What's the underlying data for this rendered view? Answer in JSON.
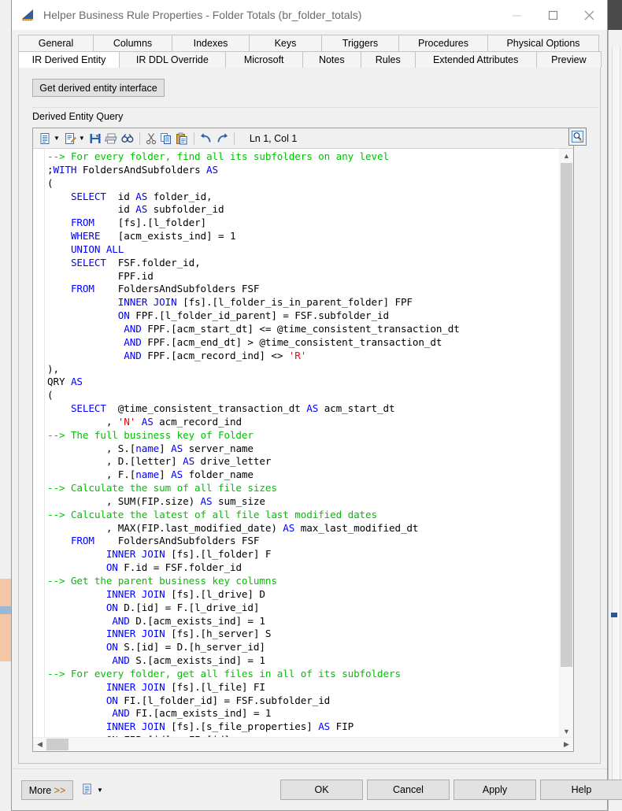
{
  "window": {
    "title": "Helper Business Rule Properties - Folder Totals (br_folder_totals)",
    "minimize_label": "–",
    "maximize_label": "☐",
    "close_label": "✕"
  },
  "tabs": {
    "row1": [
      {
        "label": "General",
        "active": false
      },
      {
        "label": "Columns",
        "active": false
      },
      {
        "label": "Indexes",
        "active": false
      },
      {
        "label": "Keys",
        "active": false
      },
      {
        "label": "Triggers",
        "active": false
      },
      {
        "label": "Procedures",
        "active": false
      },
      {
        "label": "Physical Options",
        "active": false
      }
    ],
    "row2": [
      {
        "label": "IR Derived Entity",
        "active": true
      },
      {
        "label": "IR DDL Override",
        "active": false
      },
      {
        "label": "Microsoft",
        "active": false
      },
      {
        "label": "Notes",
        "active": false
      },
      {
        "label": "Rules",
        "active": false
      },
      {
        "label": "Extended Attributes",
        "active": false
      },
      {
        "label": "Preview",
        "active": false
      }
    ]
  },
  "panel": {
    "get_derived_label": "Get derived entity interface",
    "query_label": "Derived Entity Query"
  },
  "editor_toolbar": {
    "cursor_position": "Ln 1, Col 1",
    "items": [
      {
        "name": "new-document-icon",
        "caret": true
      },
      {
        "name": "edit-document-icon",
        "caret": true
      },
      {
        "name": "save-icon",
        "caret": false
      },
      {
        "name": "print-icon",
        "caret": false
      },
      {
        "name": "find-icon",
        "caret": false
      },
      {
        "name": "cut-icon",
        "caret": false
      },
      {
        "name": "copy-icon",
        "caret": false
      },
      {
        "name": "paste-icon",
        "caret": false
      },
      {
        "name": "undo-icon",
        "caret": false
      },
      {
        "name": "redo-icon",
        "caret": false
      }
    ]
  },
  "code": {
    "language": "sql",
    "lines": [
      [
        {
          "t": "--> For every folder, find all its subfolders on any level",
          "c": "cmt"
        }
      ],
      [
        {
          "t": ";",
          "c": "plain"
        },
        {
          "t": "WITH",
          "c": "kw"
        },
        {
          "t": " FoldersAndSubfolders ",
          "c": "plain"
        },
        {
          "t": "AS",
          "c": "kw"
        }
      ],
      [
        {
          "t": "(",
          "c": "plain"
        }
      ],
      [
        {
          "t": "    ",
          "c": "plain"
        },
        {
          "t": "SELECT",
          "c": "kw"
        },
        {
          "t": "  id ",
          "c": "plain"
        },
        {
          "t": "AS",
          "c": "kw"
        },
        {
          "t": " folder_id,",
          "c": "plain"
        }
      ],
      [
        {
          "t": "            id ",
          "c": "plain"
        },
        {
          "t": "AS",
          "c": "kw"
        },
        {
          "t": " subfolder_id",
          "c": "plain"
        }
      ],
      [
        {
          "t": "    ",
          "c": "plain"
        },
        {
          "t": "FROM",
          "c": "kw"
        },
        {
          "t": "    [fs].[l_folder]",
          "c": "plain"
        }
      ],
      [
        {
          "t": "    ",
          "c": "plain"
        },
        {
          "t": "WHERE",
          "c": "kw"
        },
        {
          "t": "   [acm_exists_ind] = 1",
          "c": "plain"
        }
      ],
      [
        {
          "t": "    ",
          "c": "plain"
        },
        {
          "t": "UNION ALL",
          "c": "kw"
        }
      ],
      [
        {
          "t": "    ",
          "c": "plain"
        },
        {
          "t": "SELECT",
          "c": "kw"
        },
        {
          "t": "  FSF.folder_id,",
          "c": "plain"
        }
      ],
      [
        {
          "t": "            FPF.id",
          "c": "plain"
        }
      ],
      [
        {
          "t": "    ",
          "c": "plain"
        },
        {
          "t": "FROM",
          "c": "kw"
        },
        {
          "t": "    FoldersAndSubfolders FSF",
          "c": "plain"
        }
      ],
      [
        {
          "t": "            ",
          "c": "plain"
        },
        {
          "t": "INNER JOIN",
          "c": "kw"
        },
        {
          "t": " [fs].[l_folder_is_in_parent_folder] FPF",
          "c": "plain"
        }
      ],
      [
        {
          "t": "            ",
          "c": "plain"
        },
        {
          "t": "ON",
          "c": "kw"
        },
        {
          "t": " FPF.[l_folder_id_parent] = FSF.subfolder_id",
          "c": "plain"
        }
      ],
      [
        {
          "t": "             ",
          "c": "plain"
        },
        {
          "t": "AND",
          "c": "kw"
        },
        {
          "t": " FPF.[acm_start_dt] <= @time_consistent_transaction_dt",
          "c": "plain"
        }
      ],
      [
        {
          "t": "             ",
          "c": "plain"
        },
        {
          "t": "AND",
          "c": "kw"
        },
        {
          "t": " FPF.[acm_end_dt] > @time_consistent_transaction_dt",
          "c": "plain"
        }
      ],
      [
        {
          "t": "             ",
          "c": "plain"
        },
        {
          "t": "AND",
          "c": "kw"
        },
        {
          "t": " FPF.[acm_record_ind] <> ",
          "c": "plain"
        },
        {
          "t": "'R'",
          "c": "str"
        }
      ],
      [
        {
          "t": "),",
          "c": "plain"
        }
      ],
      [
        {
          "t": "QRY ",
          "c": "plain"
        },
        {
          "t": "AS",
          "c": "kw"
        }
      ],
      [
        {
          "t": "(",
          "c": "plain"
        }
      ],
      [
        {
          "t": "    ",
          "c": "plain"
        },
        {
          "t": "SELECT",
          "c": "kw"
        },
        {
          "t": "  @time_consistent_transaction_dt ",
          "c": "plain"
        },
        {
          "t": "AS",
          "c": "kw"
        },
        {
          "t": " acm_start_dt",
          "c": "plain"
        }
      ],
      [
        {
          "t": "          , ",
          "c": "plain"
        },
        {
          "t": "'N'",
          "c": "str"
        },
        {
          "t": " ",
          "c": "plain"
        },
        {
          "t": "AS",
          "c": "kw"
        },
        {
          "t": " acm_record_ind",
          "c": "plain"
        }
      ],
      [
        {
          "t": "--> The full business key of Folder",
          "c": "cmt"
        }
      ],
      [
        {
          "t": "          , S.[",
          "c": "plain"
        },
        {
          "t": "name",
          "c": "kw"
        },
        {
          "t": "] ",
          "c": "plain"
        },
        {
          "t": "AS",
          "c": "kw"
        },
        {
          "t": " server_name",
          "c": "plain"
        }
      ],
      [
        {
          "t": "          , D.[letter] ",
          "c": "plain"
        },
        {
          "t": "AS",
          "c": "kw"
        },
        {
          "t": " drive_letter",
          "c": "plain"
        }
      ],
      [
        {
          "t": "          , F.[",
          "c": "plain"
        },
        {
          "t": "name",
          "c": "kw"
        },
        {
          "t": "] ",
          "c": "plain"
        },
        {
          "t": "AS",
          "c": "kw"
        },
        {
          "t": " folder_name",
          "c": "plain"
        }
      ],
      [
        {
          "t": "--> Calculate the sum of all file sizes",
          "c": "cmt"
        }
      ],
      [
        {
          "t": "          , SUM(FIP.size) ",
          "c": "plain"
        },
        {
          "t": "AS",
          "c": "kw"
        },
        {
          "t": " sum_size",
          "c": "plain"
        }
      ],
      [
        {
          "t": "--> Calculate the latest of all file last modified dates",
          "c": "cmt"
        }
      ],
      [
        {
          "t": "          , MAX(FIP.last_modified_date) ",
          "c": "plain"
        },
        {
          "t": "AS",
          "c": "kw"
        },
        {
          "t": " max_last_modified_dt",
          "c": "plain"
        }
      ],
      [
        {
          "t": "    ",
          "c": "plain"
        },
        {
          "t": "FROM",
          "c": "kw"
        },
        {
          "t": "    FoldersAndSubfolders FSF",
          "c": "plain"
        }
      ],
      [
        {
          "t": "          ",
          "c": "plain"
        },
        {
          "t": "INNER JOIN",
          "c": "kw"
        },
        {
          "t": " [fs].[l_folder] F",
          "c": "plain"
        }
      ],
      [
        {
          "t": "          ",
          "c": "plain"
        },
        {
          "t": "ON",
          "c": "kw"
        },
        {
          "t": " F.id = FSF.folder_id",
          "c": "plain"
        }
      ],
      [
        {
          "t": "--> Get the parent business key columns",
          "c": "cmt"
        }
      ],
      [
        {
          "t": "          ",
          "c": "plain"
        },
        {
          "t": "INNER JOIN",
          "c": "kw"
        },
        {
          "t": " [fs].[l_drive] D",
          "c": "plain"
        }
      ],
      [
        {
          "t": "          ",
          "c": "plain"
        },
        {
          "t": "ON",
          "c": "kw"
        },
        {
          "t": " D.[id] = F.[l_drive_id]",
          "c": "plain"
        }
      ],
      [
        {
          "t": "           ",
          "c": "plain"
        },
        {
          "t": "AND",
          "c": "kw"
        },
        {
          "t": " D.[acm_exists_ind] = 1",
          "c": "plain"
        }
      ],
      [
        {
          "t": "          ",
          "c": "plain"
        },
        {
          "t": "INNER JOIN",
          "c": "kw"
        },
        {
          "t": " [fs].[h_server] S",
          "c": "plain"
        }
      ],
      [
        {
          "t": "          ",
          "c": "plain"
        },
        {
          "t": "ON",
          "c": "kw"
        },
        {
          "t": " S.[id] = D.[h_server_id]",
          "c": "plain"
        }
      ],
      [
        {
          "t": "           ",
          "c": "plain"
        },
        {
          "t": "AND",
          "c": "kw"
        },
        {
          "t": " S.[acm_exists_ind] = 1",
          "c": "plain"
        }
      ],
      [
        {
          "t": "--> For every folder, get all files in all of its subfolders",
          "c": "cmt"
        }
      ],
      [
        {
          "t": "          ",
          "c": "plain"
        },
        {
          "t": "INNER JOIN",
          "c": "kw"
        },
        {
          "t": " [fs].[l_file] FI",
          "c": "plain"
        }
      ],
      [
        {
          "t": "          ",
          "c": "plain"
        },
        {
          "t": "ON",
          "c": "kw"
        },
        {
          "t": " FI.[l_folder_id] = FSF.subfolder_id",
          "c": "plain"
        }
      ],
      [
        {
          "t": "           ",
          "c": "plain"
        },
        {
          "t": "AND",
          "c": "kw"
        },
        {
          "t": " FI.[acm_exists_ind] = 1",
          "c": "plain"
        }
      ],
      [
        {
          "t": "          ",
          "c": "plain"
        },
        {
          "t": "INNER JOIN",
          "c": "kw"
        },
        {
          "t": " [fs].[s_file_properties] ",
          "c": "plain"
        },
        {
          "t": "AS",
          "c": "kw"
        },
        {
          "t": " FIP",
          "c": "plain"
        }
      ],
      [
        {
          "t": "          ",
          "c": "plain"
        },
        {
          "t": "ON",
          "c": "kw"
        },
        {
          "t": " FIP.[id] = FI.[id]",
          "c": "plain"
        }
      ]
    ]
  },
  "footer": {
    "more_label_text": "More ",
    "more_label_gt": ">>",
    "ok_label": "OK",
    "cancel_label": "Cancel",
    "apply_label": "Apply",
    "help_label": "Help"
  },
  "colors": {
    "keyword": "#0000ff",
    "comment": "#00c000",
    "string": "#ff0000",
    "dialog_bg": "#f0f0f0",
    "button_bg": "#e1e1e1",
    "titlebar_bg": "#ffffff"
  }
}
